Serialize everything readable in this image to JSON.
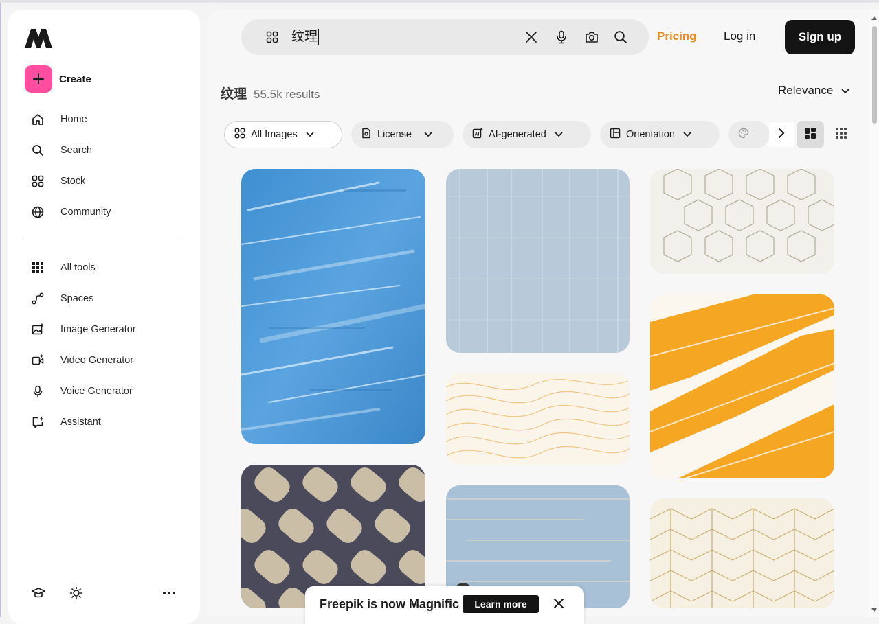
{
  "sidebar": {
    "create_label": "Create",
    "nav_primary": [
      {
        "label": "Home",
        "icon": "home-icon"
      },
      {
        "label": "Search",
        "icon": "search-icon"
      },
      {
        "label": "Stock",
        "icon": "stock-icon"
      },
      {
        "label": "Community",
        "icon": "globe-icon"
      }
    ],
    "nav_tools": [
      {
        "label": "All tools",
        "icon": "grid-icon"
      },
      {
        "label": "Spaces",
        "icon": "spaces-icon"
      },
      {
        "label": "Image Generator",
        "icon": "image-generator-icon"
      },
      {
        "label": "Video Generator",
        "icon": "video-generator-icon"
      },
      {
        "label": "Voice Generator",
        "icon": "microphone-icon"
      },
      {
        "label": "Assistant",
        "icon": "assistant-icon"
      }
    ],
    "bottom_icons": [
      "graduation-cap-icon",
      "sun-icon",
      "more-icon"
    ]
  },
  "header": {
    "search_value": "纹理",
    "pricing_label": "Pricing",
    "login_label": "Log in",
    "signup_label": "Sign up"
  },
  "results": {
    "query": "纹理",
    "count": "55.5k results",
    "sort_label": "Relevance"
  },
  "filters": [
    {
      "label": "All Images",
      "icon": "grid-icon"
    },
    {
      "label": "License",
      "icon": "license-icon"
    },
    {
      "label": "AI-generated",
      "icon": "ai-icon"
    },
    {
      "label": "Orientation",
      "icon": "orientation-icon"
    }
  ],
  "banner": {
    "text": "Freepik is now Magnific",
    "learn_more_label": "Learn more"
  },
  "colors": {
    "accent_pink": "#ff4ea0",
    "pricing_orange": "#ea8a1f",
    "dark": "#141414"
  }
}
